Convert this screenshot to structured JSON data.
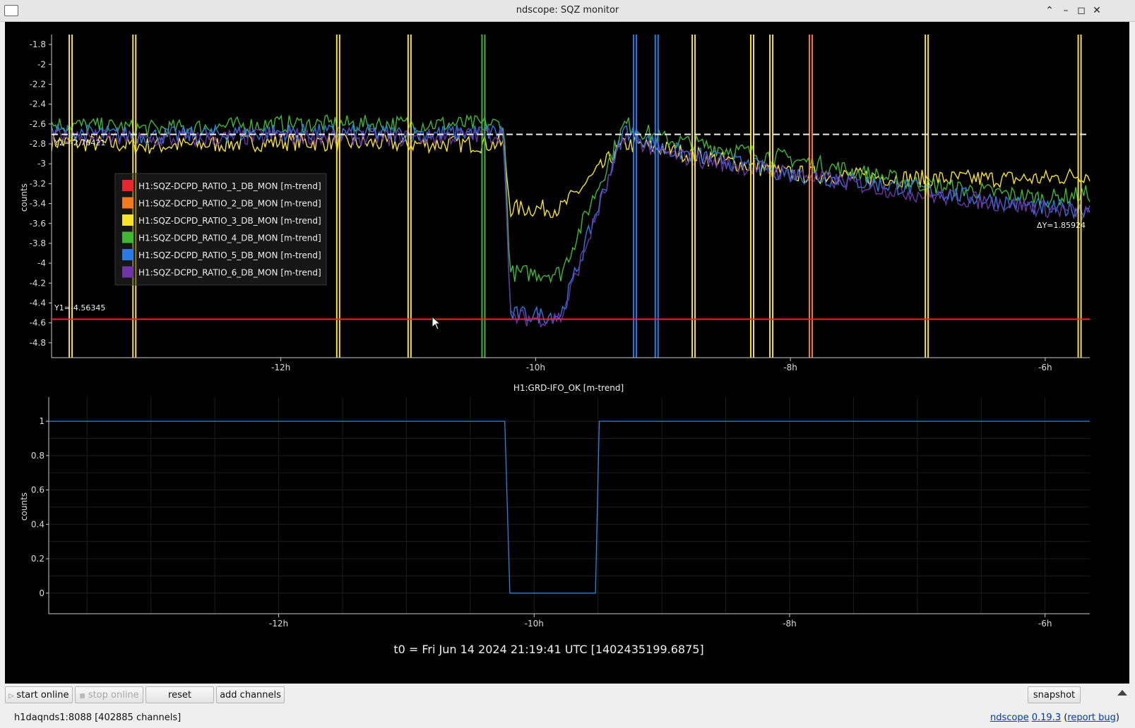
{
  "window": {
    "title": "ndscope: SQZ monitor"
  },
  "top_plot": {
    "ylabel": "counts",
    "y_ticks": [
      "-1.8",
      "-2",
      "-2.2",
      "-2.4",
      "-2.6",
      "-2.8",
      "-3",
      "-3.2",
      "-3.4",
      "-3.6",
      "-3.8",
      "-4",
      "-4.2",
      "-4.4",
      "-4.6",
      "-4.8"
    ],
    "x_ticks": [
      "-12h",
      "-10h",
      "-8h",
      "-6h"
    ],
    "cursor_y1_label": "Y1=-4.56345",
    "cursor_y2_label": "Y2=-2.70421",
    "delta_y_label": "ΔY=1.85924",
    "cursor_y1_value": -4.56345,
    "cursor_y2_value": -2.70421,
    "legend": [
      {
        "label": "H1:SQZ-DCPD_RATIO_1_DB_MON [m-trend]",
        "color": "#e8262b"
      },
      {
        "label": "H1:SQZ-DCPD_RATIO_2_DB_MON [m-trend]",
        "color": "#f5791f"
      },
      {
        "label": "H1:SQZ-DCPD_RATIO_3_DB_MON [m-trend]",
        "color": "#f8e32a"
      },
      {
        "label": "H1:SQZ-DCPD_RATIO_4_DB_MON [m-trend]",
        "color": "#41b833"
      },
      {
        "label": "H1:SQZ-DCPD_RATIO_5_DB_MON [m-trend]",
        "color": "#2a7ae6"
      },
      {
        "label": "H1:SQZ-DCPD_RATIO_6_DB_MON [m-trend]",
        "color": "#6d35a6"
      }
    ],
    "cursor_color": "#ff2020"
  },
  "bottom_plot": {
    "title": "H1:GRD-IFO_OK [m-trend]",
    "ylabel": "counts",
    "y_ticks": [
      "1",
      "0.8",
      "0.6",
      "0.4",
      "0.2",
      "0"
    ],
    "x_ticks": [
      "-12h",
      "-10h",
      "-8h",
      "-6h"
    ],
    "line_color": "#2a82e6"
  },
  "t0_label": "t0 = Fri Jun 14 2024 21:19:41 UTC [1402435199.6875]",
  "toolbar": {
    "start_online": "start online",
    "stop_online": "stop online",
    "reset": "reset",
    "add_channels": "add channels",
    "snapshot": "snapshot"
  },
  "status": {
    "connection": "h1daqnds1:8088  [402885 channels]",
    "app_name": "ndscope",
    "version": "0.19.3",
    "report_bug": "report bug"
  },
  "chart_data": [
    {
      "type": "line",
      "title": "",
      "xlabel": "",
      "ylabel": "counts",
      "x_unit": "hours",
      "xlim": [
        -13.8,
        -5.65
      ],
      "ylim": [
        -4.95,
        -1.7
      ],
      "grid": false,
      "legend_position": "left",
      "series": [
        {
          "name": "H1:SQZ-DCPD_RATIO_3_DB_MON [m-trend]",
          "x": [
            -13.8,
            -13,
            -12,
            -11,
            -10.25,
            -10.2,
            -9.8,
            -9.3,
            -9,
            -8,
            -7,
            -6,
            -5.65
          ],
          "y": [
            -2.78,
            -2.82,
            -2.78,
            -2.8,
            -2.8,
            -3.45,
            -3.45,
            -2.8,
            -2.85,
            -3.1,
            -3.15,
            -3.15,
            -3.1
          ]
        },
        {
          "name": "H1:SQZ-DCPD_RATIO_4_DB_MON [m-trend]",
          "x": [
            -13.8,
            -13,
            -12,
            -11,
            -10.25,
            -10.2,
            -9.8,
            -9.3,
            -9,
            -8,
            -7,
            -6,
            -5.65
          ],
          "y": [
            -2.6,
            -2.65,
            -2.6,
            -2.6,
            -2.6,
            -4.1,
            -4.1,
            -2.6,
            -2.75,
            -2.95,
            -3.2,
            -3.35,
            -3.3
          ]
        },
        {
          "name": "H1:SQZ-DCPD_RATIO_5_DB_MON [m-trend]",
          "x": [
            -13.8,
            -13,
            -12,
            -11,
            -10.25,
            -10.2,
            -9.8,
            -9.3,
            -9,
            -8,
            -7,
            -6,
            -5.65
          ],
          "y": [
            -2.68,
            -2.72,
            -2.68,
            -2.7,
            -2.68,
            -4.52,
            -4.52,
            -2.65,
            -2.85,
            -3.1,
            -3.25,
            -3.45,
            -3.45
          ]
        },
        {
          "name": "H1:SQZ-DCPD_RATIO_6_DB_MON [m-trend]",
          "x": [
            -13.8,
            -13,
            -12,
            -11,
            -10.25,
            -10.2,
            -9.8,
            -9.3,
            -9,
            -8,
            -7,
            -6,
            -5.65
          ],
          "y": [
            -2.72,
            -2.76,
            -2.72,
            -2.74,
            -2.7,
            -4.55,
            -4.55,
            -2.7,
            -2.9,
            -3.1,
            -3.3,
            -3.45,
            -3.5
          ]
        }
      ],
      "spikes": [
        {
          "x": -13.65,
          "series": 2
        },
        {
          "x": -13.15,
          "series": 2
        },
        {
          "x": -11.55,
          "series": 2
        },
        {
          "x": -10.99,
          "series": 2
        },
        {
          "x": -10.41,
          "series": 3
        },
        {
          "x": -9.22,
          "series": 4
        },
        {
          "x": -9.05,
          "series": 4
        },
        {
          "x": -8.76,
          "series": 2
        },
        {
          "x": -8.3,
          "series": 2
        },
        {
          "x": -8.15,
          "series": 2
        },
        {
          "x": -7.84,
          "series": 1
        },
        {
          "x": -6.93,
          "series": 2
        },
        {
          "x": -5.73,
          "series": 2
        }
      ]
    },
    {
      "type": "line",
      "title": "H1:GRD-IFO_OK [m-trend]",
      "xlabel": "",
      "ylabel": "counts",
      "x_unit": "hours",
      "xlim": [
        -13.8,
        -5.65
      ],
      "ylim": [
        -0.12,
        1.14
      ],
      "grid": true,
      "series": [
        {
          "name": "H1:GRD-IFO_OK [m-trend]",
          "x": [
            -13.8,
            -10.23,
            -10.19,
            -9.52,
            -9.49,
            -5.65
          ],
          "y": [
            1,
            1,
            0,
            0,
            1,
            1
          ]
        }
      ]
    }
  ]
}
